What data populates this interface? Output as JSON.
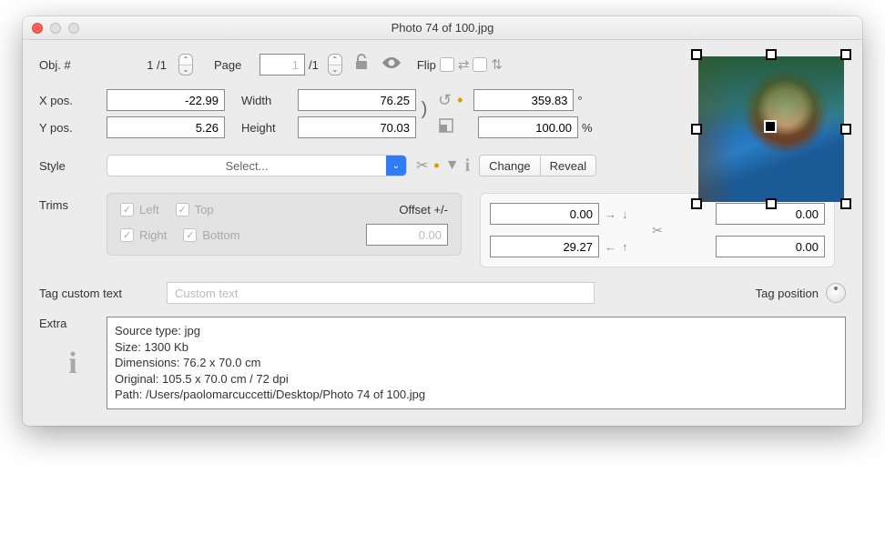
{
  "title": "Photo 74 of 100.jpg",
  "obj": {
    "label": "Obj. #",
    "current": "1",
    "sep": "/",
    "total": "1"
  },
  "page": {
    "label": "Page",
    "current": "1",
    "sep": "/",
    "total": "1"
  },
  "flip": {
    "label": "Flip"
  },
  "xpos": {
    "label": "X pos.",
    "value": "-22.99"
  },
  "ypos": {
    "label": "Y pos.",
    "value": "5.26"
  },
  "width": {
    "label": "Width",
    "value": "76.25"
  },
  "height": {
    "label": "Height",
    "value": "70.03"
  },
  "rotation": {
    "value": "359.83",
    "unit": "°"
  },
  "scale": {
    "value": "100.00",
    "unit": "%"
  },
  "style": {
    "label": "Style",
    "placeholder": "Select..."
  },
  "change_btn": "Change",
  "reveal_btn": "Reveal",
  "trims": {
    "label": "Trims",
    "left": "Left",
    "right": "Right",
    "top": "Top",
    "bottom": "Bottom",
    "offset_label": "Offset +/-",
    "offset_value": "0.00"
  },
  "crop": {
    "tl": "0.00",
    "tr": "0.00",
    "bl": "29.27",
    "br": "0.00"
  },
  "tag_custom": {
    "label": "Tag custom text",
    "placeholder": "Custom text"
  },
  "tag_position": {
    "label": "Tag position"
  },
  "extra": {
    "label": "Extra",
    "line1": "Source type: jpg",
    "line2": "Size: 1300 Kb",
    "line3": "Dimensions: 76.2 x 70.0 cm",
    "line4": "Original: 105.5 x 70.0 cm  / 72 dpi",
    "line5": "Path: /Users/paolomarcuccetti/Desktop/Photo 74 of 100.jpg"
  }
}
